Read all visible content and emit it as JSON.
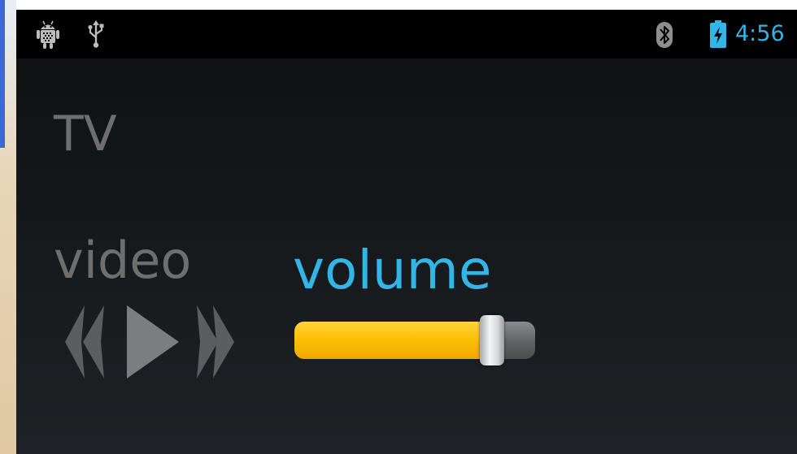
{
  "status_bar": {
    "clock": "4:56",
    "icons": [
      "android-debug-icon",
      "usb-icon",
      "bluetooth-icon",
      "battery-charging-icon"
    ]
  },
  "app": {
    "title": "TV"
  },
  "video": {
    "label": "video",
    "controls": [
      "rewind-icon",
      "play-icon",
      "fast-forward-icon"
    ]
  },
  "volume": {
    "label": "volume",
    "level": 0.82
  },
  "colors": {
    "accent_blue": "#33b5e5",
    "label_gray": "#6e6e6e",
    "slider_fill": "#ffc107",
    "control_gray": "#5b5d5f"
  }
}
